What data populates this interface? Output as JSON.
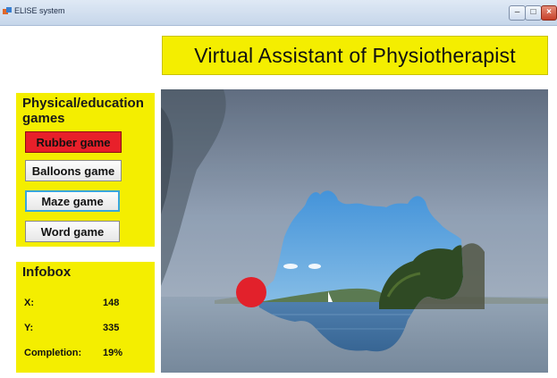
{
  "window": {
    "title": "ELISE system",
    "controls": [
      "–",
      "□",
      "×"
    ]
  },
  "header": {
    "title": "Virtual Assistant of Physiotherapist"
  },
  "games_panel": {
    "title": "Physical/education games",
    "buttons": {
      "rubber": "Rubber game",
      "balloons": "Balloons game",
      "maze": "Maze game",
      "word": "Word game"
    },
    "active_color": "#e8202a",
    "focus_color": "#39a6dc"
  },
  "infobox": {
    "title": "Infobox",
    "x_label": "X:",
    "x_value": "148",
    "y_label": "Y:",
    "y_value": "335",
    "completion_label": "Completion:",
    "completion_value": "19%"
  },
  "game_area": {
    "background": "lake landscape photo with scratched-off reveal area",
    "cursor_color": "#e2212b"
  },
  "colors": {
    "panel_yellow": "#f4ee00"
  }
}
